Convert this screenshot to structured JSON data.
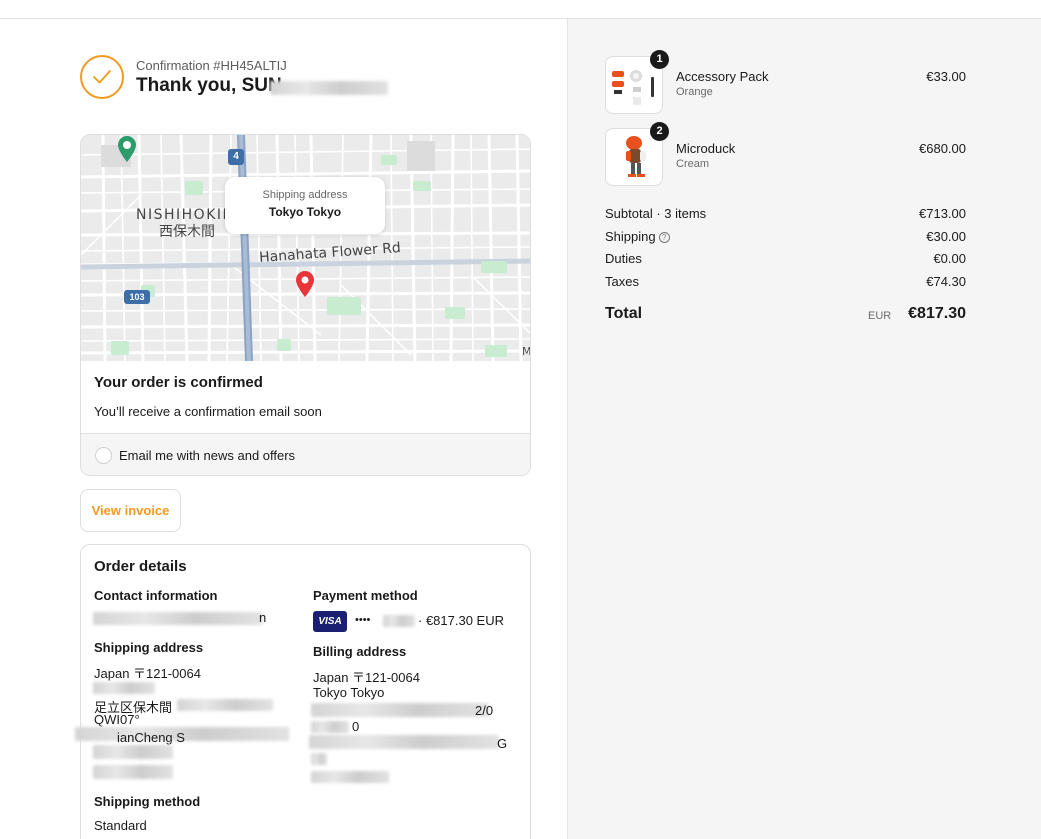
{
  "header": {
    "confirmation": "Confirmation #HH45ALTIJ",
    "thanks": "Thank you, SUN"
  },
  "map": {
    "bubble_label": "Shipping address",
    "bubble_value": "Tokyo Tokyo",
    "district_en": "NISHIHOKIN",
    "district_jp": "西保木間",
    "road_label": "Hanahata Flower Rd",
    "route_4": "4",
    "route_103": "103",
    "corner_letter": "M"
  },
  "order_status": {
    "title": "Your order is confirmed",
    "subtitle": "You’ll receive a confirmation email soon",
    "news_label": "Email me with news and offers"
  },
  "invoice_button": "View invoice",
  "details": {
    "title": "Order details",
    "contact_heading": "Contact information",
    "contact_suffix": "n",
    "payment_heading": "Payment method",
    "card_brand": "VISA",
    "card_dots": "••••",
    "payment_amount": "· €817.30 EUR",
    "shipping_heading": "Shipping address",
    "shipping_line1": "Japan 〒121-0064",
    "shipping_partial_a": "足立区保木間",
    "shipping_partial_b": "QWI07°",
    "shipping_partial_c": "ianCheng S",
    "billing_heading": "Billing address",
    "billing_line1": "Japan 〒121-0064",
    "billing_line2": "Tokyo Tokyo",
    "billing_partial_a": "0",
    "billing_partial_b": "G",
    "billing_partial_c": "2/0",
    "method_heading": "Shipping method",
    "method_value": "Standard"
  },
  "items": [
    {
      "name": "Accessory Pack",
      "variant": "Orange",
      "price": "€33.00",
      "qty": "1"
    },
    {
      "name": "Microduck",
      "variant": "Cream",
      "price": "€680.00",
      "qty": "2"
    }
  ],
  "summary": {
    "subtotal_label": "Subtotal · 3 items",
    "subtotal": "€713.00",
    "shipping_label": "Shipping",
    "shipping": "€30.00",
    "duties_label": "Duties",
    "duties": "€0.00",
    "taxes_label": "Taxes",
    "taxes": "€74.30",
    "total_label": "Total",
    "currency": "EUR",
    "total": "€817.30"
  },
  "colors": {
    "accent": "#f29a1f",
    "pin": "#e8353a",
    "pin_green": "#2a9d6a",
    "visa": "#1a1f71"
  }
}
